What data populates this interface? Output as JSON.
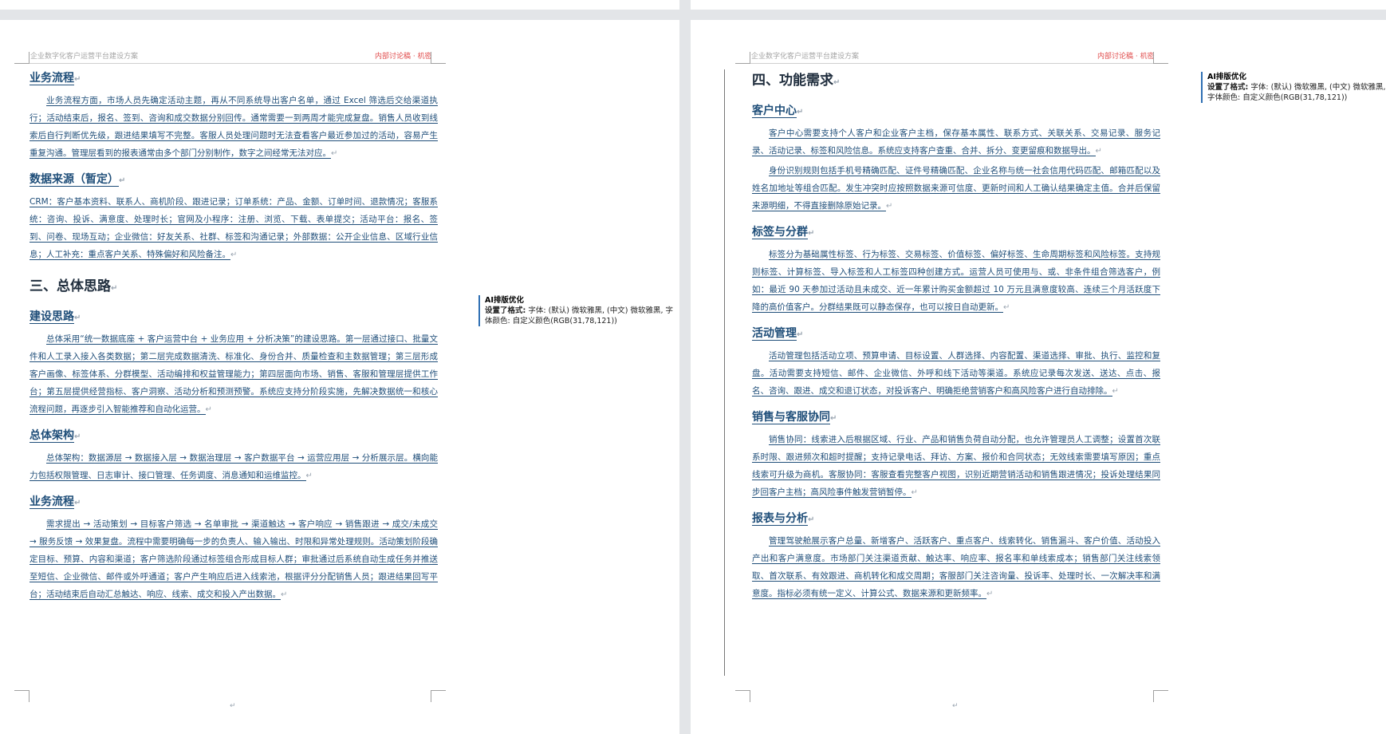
{
  "page1": {
    "header_left": "企业数字化客户运营平台建设方案",
    "header_right": "内部讨论稿 · 机密",
    "blocks": [
      {
        "type": "h2",
        "text": "业务流程"
      },
      {
        "type": "p",
        "text": "业务流程方面，市场人员先确定活动主题，再从不同系统导出客户名单，通过 Excel 筛选后交给渠道执行；活动结束后，报名、签到、咨询和成交数据分别回传。通常需要一到两周才能完成复盘。销售人员收到线索后自行判断优先级，跟进结果填写不完整。客服人员处理问题时无法查看客户最近参加过的活动，容易产生重复沟通。管理层看到的报表通常由多个部门分别制作，数字之间经常无法对应。"
      },
      {
        "type": "h2",
        "text": "数据来源（暂定）"
      },
      {
        "type": "pn",
        "text": "CRM：客户基本资料、联系人、商机阶段、跟进记录；订单系统：产品、金额、订单时间、退款情况；客服系统：咨询、投诉、满意度、处理时长；官网及小程序：注册、浏览、下载、表单提交；活动平台：报名、签到、问卷、现场互动；企业微信：好友关系、社群、标签和沟通记录；外部数据：公开企业信息、区域行业信息；人工补充：重点客户关系、特殊偏好和风险备注。"
      },
      {
        "type": "h1",
        "text": "三、总体思路"
      },
      {
        "type": "h2",
        "text": "建设思路"
      },
      {
        "type": "p",
        "text": "总体采用“统一数据底座 + 客户运营中台 + 业务应用 + 分析决策”的建设思路。第一层通过接口、批量文件和人工录入接入各类数据；第二层完成数据清洗、标准化、身份合并、质量检查和主数据管理；第三层形成客户画像、标签体系、分群模型、活动编排和权益管理能力；第四层面向市场、销售、客服和管理层提供工作台；第五层提供经营指标、客户洞察、活动分析和预测预警。系统应支持分阶段实施，先解决数据统一和核心流程问题，再逐步引入智能推荐和自动化运营。"
      },
      {
        "type": "h2",
        "text": "总体架构"
      },
      {
        "type": "p",
        "text": "总体架构：数据源层 → 数据接入层 → 数据治理层 → 客户数据平台 → 运营应用层 → 分析展示层。横向能力包括权限管理、日志审计、接口管理、任务调度、消息通知和运维监控。"
      },
      {
        "type": "h2",
        "text": "业务流程"
      },
      {
        "type": "p",
        "text": "需求提出 → 活动策划 → 目标客户筛选 → 名单审批 → 渠道触达 → 客户响应 → 销售跟进 → 成交/未成交 → 服务反馈 → 效果复盘。流程中需要明确每一步的负责人、输入输出、时限和异常处理规则。活动策划阶段确定目标、预算、内容和渠道；客户筛选阶段通过标签组合形成目标人群；审批通过后系统自动生成任务并推送至短信、企业微信、邮件或外呼通道；客户产生响应后进入线索池，根据评分分配销售人员；跟进结果回写平台；活动结束后自动汇总触达、响应、线索、成交和投入产出数据。"
      }
    ]
  },
  "page2": {
    "header_left": "企业数字化客户运营平台建设方案",
    "header_right": "内部讨论稿 · 机密",
    "blocks": [
      {
        "type": "h1",
        "text": "四、功能需求"
      },
      {
        "type": "h2",
        "text": "客户中心"
      },
      {
        "type": "p",
        "text": "客户中心需要支持个人客户和企业客户主档，保存基本属性、联系方式、关联关系、交易记录、服务记录、活动记录、标签和风险信息。系统应支持客户查重、合并、拆分、变更留痕和数据导出。"
      },
      {
        "type": "p",
        "text": "身份识别规则包括手机号精确匹配、证件号精确匹配、企业名称与统一社会信用代码匹配、邮箱匹配以及姓名加地址等组合匹配。发生冲突时应按照数据来源可信度、更新时间和人工确认结果确定主值。合并后保留来源明细，不得直接删除原始记录。"
      },
      {
        "type": "h2",
        "text": "标签与分群"
      },
      {
        "type": "p",
        "text": "标签分为基础属性标签、行为标签、交易标签、价值标签、偏好标签、生命周期标签和风险标签。支持规则标签、计算标签、导入标签和人工标签四种创建方式。运营人员可使用与、或、非条件组合筛选客户，例如：最近 90 天参加过活动且未成交、近一年累计购买金额超过 10 万元且满意度较高、连续三个月活跃度下降的高价值客户。分群结果既可以静态保存，也可以按日自动更新。"
      },
      {
        "type": "h2",
        "text": "活动管理"
      },
      {
        "type": "p",
        "text": "活动管理包括活动立项、预算申请、目标设置、人群选择、内容配置、渠道选择、审批、执行、监控和复盘。活动需要支持短信、邮件、企业微信、外呼和线下活动等渠道。系统应记录每次发送、送达、点击、报名、咨询、跟进、成交和退订状态，对投诉客户、明确拒绝营销客户和高风险客户进行自动排除。"
      },
      {
        "type": "h2",
        "text": "销售与客服协同"
      },
      {
        "type": "p",
        "text": "销售协同：线索进入后根据区域、行业、产品和销售负荷自动分配，也允许管理员人工调整；设置首次联系时限、跟进频次和超时提醒；支持记录电话、拜访、方案、报价和合同状态；无效线索需要填写原因；重点线索可升级为商机。客服协同：客服查看完整客户视图，识别近期营销活动和销售跟进情况；投诉处理结果同步回客户主档；高风险事件触发营销暂停。"
      },
      {
        "type": "h2",
        "text": "报表与分析"
      },
      {
        "type": "p",
        "text": "管理驾驶舱展示客户总量、新增客户、活跃客户、重点客户、线索转化、销售漏斗、客户价值、活动投入产出和客户满意度。市场部门关注渠道贡献、触达率、响应率、报名率和单线索成本；销售部门关注线索领取、首次联系、有效跟进、商机转化和成交周期；客服部门关注咨询量、投诉率、处理时长、一次解决率和满意度。指标必须有统一定义、计算公式、数据来源和更新频率。"
      }
    ]
  },
  "comments": [
    {
      "title": "AI排版优化",
      "label": "设置了格式:",
      "text": "字体: (默认) 微软雅黑, (中文) 微软雅黑, 字体颜色: 自定义颜色(RGB(31,78,121))"
    },
    {
      "title": "AI排版优化",
      "label": "设置了格式:",
      "text": "字体: (默认) 微软雅黑, (中文) 微软雅黑, 字体颜色: 自定义颜色(RGB(31,78,121))"
    }
  ],
  "colors": {
    "heading": "#1f2d3d",
    "body": "#1f4e79",
    "header_red": "#e04b4b",
    "comment_bar": "#2f6fb3"
  },
  "para_mark": "↵"
}
